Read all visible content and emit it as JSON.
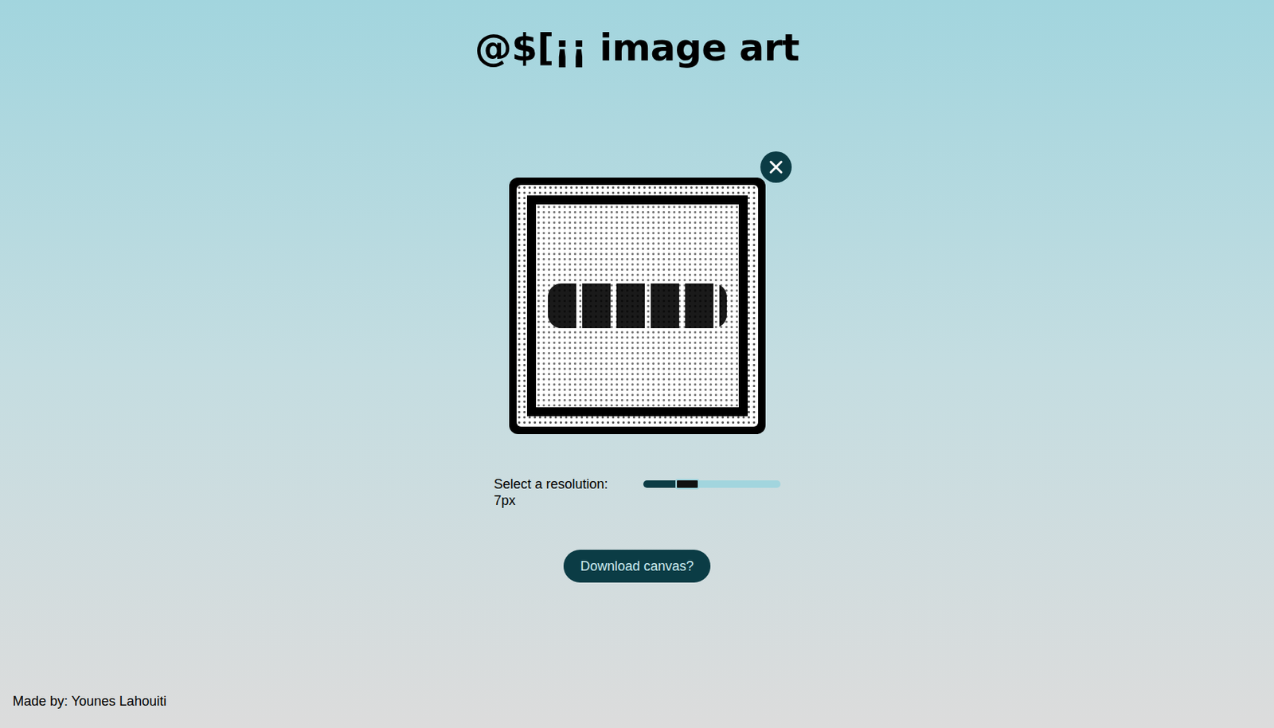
{
  "title": "@$[¡¡ image art",
  "slider": {
    "label": "Select a resolution:",
    "reading": "7px",
    "level": 0.31
  },
  "download_button": "Download canvas?",
  "footer": "Made by: Younes Lahouiti"
}
